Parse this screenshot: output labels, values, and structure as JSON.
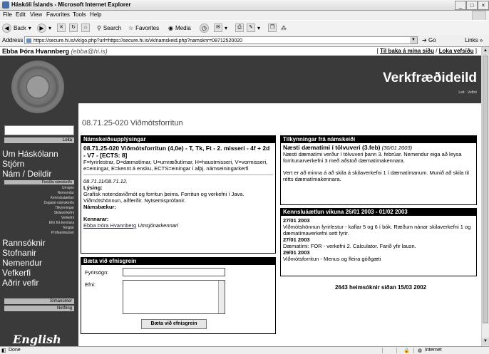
{
  "window": {
    "title": "Háskóli Íslands - Microsoft Internet Explorer",
    "controls": [
      "_",
      "□",
      "×"
    ]
  },
  "menu": [
    "File",
    "Edit",
    "View",
    "Favorites",
    "Tools",
    "Help"
  ],
  "toolbar": {
    "back_label": "Back",
    "search_label": "Search",
    "favorites_label": "Favorites",
    "media_label": "Media"
  },
  "address": {
    "label": "Address",
    "url": "https://secure.hi.is/vk/go.php?url=https://secure.hi.is/vk/namskeid.php?namsknr=08712520020",
    "go_label": "Go",
    "links_label": "Links »"
  },
  "user": {
    "name": "Ebba Þóra Hvannberg",
    "email": "(ebba@hi.is)",
    "back_link": "Til baka á mína síðu",
    "close_link": "Loka vefsíðu"
  },
  "sidebar": {
    "search_button": "Leita",
    "main_items": [
      "Um Háskólann",
      "Stjórn",
      "Nám / Deildir"
    ],
    "sub_items": [
      "Forsíða námskeiðs",
      "Umsjón",
      "Nemendur",
      "Kennsluáætlun",
      "Dagatal námskeiðs",
      "Tilkynningar",
      "Skilaverkefni",
      "Verkefni",
      "Efni frá kennara",
      "Tenglar",
      "Prófaeinkunnir"
    ],
    "main_items2": [
      "Rannsóknir",
      "Stofnanir",
      "Nemendur",
      "Vefkerfi",
      "Aðrir vefir"
    ],
    "boxes": [
      "Símanúmer",
      "Netföng"
    ],
    "english": "English"
  },
  "header": {
    "title": "Verkfræðideild",
    "sublinks": "Leit · Veftré"
  },
  "course": {
    "page_title": "08.71.25-020 Viðmótsforritun"
  },
  "info": {
    "heading": "Námskeiðsupplýsingar",
    "code_title": "08.71.25-020 Viðmótsforritun (4,0e) - T, Tk, Ft - 2. misseri - 4f + 2d - V7 - [ECTS: 8]",
    "legend": "F=fyrirlestrar, D=dæmatímar, U=umræðutímar, H=haustmisseri, V=vormisseri, e=einingar, E=kennt á ensku, ECTS=einingar í alþj. námseiningarkerfi",
    "dates": "08.71.11/08.71.12.",
    "desc_label": "Lýsing:",
    "desc": "Grafísk notendaviðmót og forritun þeirra. Forritun og verkefni í Java. Viðmótshönnun, aðferðir. Nytsemisprófanir.",
    "books_label": "Námsbækur:",
    "teachers_label": "Kennarar:",
    "teacher_name": "Ebba Þóra Hvannberg",
    "teacher_role": "Umsjónarkennari"
  },
  "announcements": {
    "heading": "Tilkynningar frá námskeiði",
    "title": "Næsti dæmatími í tölvuveri (3.feb)",
    "date": "(30/01 2003)",
    "body1": "Næsti dæmatími verður í tölvuveri þann 3. febrúar. Nemendur eiga að leysa forritunarverkefni 3 með aðstoð dæmatímakennara.",
    "body2": "Vert er að minna á að skila á skilaverkefni 1 í dæmatímanum. Munið að skila til rétts dæmatímakennara."
  },
  "schedule": {
    "heading": "Kennsluáætlun vikuna 26/01 2003 - 01/02 2003",
    "entries": [
      {
        "date": "27/01 2003",
        "text": "Viðmótshönnun fyrirlestur - kaflar 5 og 6 í bók. Ræðum nánar skilaverkefni 1 og dæmatímaverkefni sett fyrir."
      },
      {
        "date": "27/01 2003",
        "text": "Dæmatími: FOR - verkefni 2. Calculator. Farið yfir lausn."
      },
      {
        "date": "29/01 2003",
        "text": "Viðmótsforritun - Menus og fleira góðgæti"
      }
    ]
  },
  "addtopic": {
    "heading": "Bæta við efnisgrein",
    "title_label": "Fyrirsögn:",
    "body_label": "Efni:",
    "submit": "Bæta við efnisgrein"
  },
  "counter": "2643 heimsóknir síðan 15/03 2002",
  "status": {
    "left": "Done",
    "zone": "Internet"
  }
}
